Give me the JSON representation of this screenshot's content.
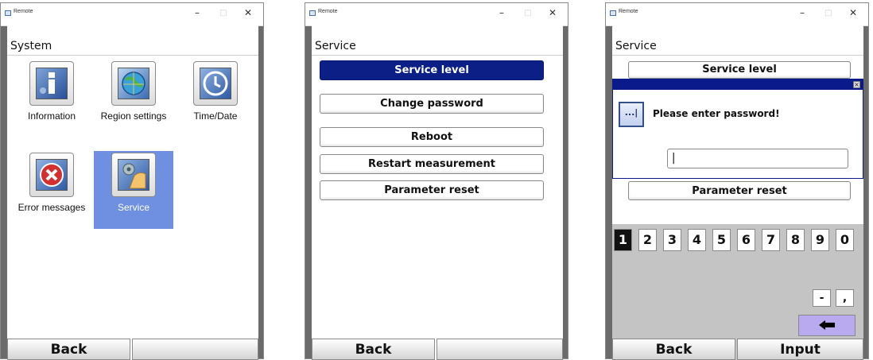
{
  "window": {
    "title": "Remote",
    "controls": {
      "minimize": "–",
      "maximize": "□",
      "close": "✕"
    }
  },
  "panel1": {
    "heading": "System",
    "tiles": [
      {
        "label": "Information",
        "icon": "info-icon"
      },
      {
        "label": "Region settings",
        "icon": "globe-icon"
      },
      {
        "label": "Time/Date",
        "icon": "clock-icon"
      },
      {
        "label": "Error messages",
        "icon": "error-icon"
      },
      {
        "label": "Service",
        "icon": "service-icon",
        "selected": true
      }
    ],
    "bottom": {
      "left": "Back",
      "right": ""
    }
  },
  "panel2": {
    "heading": "Service",
    "buttons": [
      {
        "label": "Service level",
        "active": true
      },
      {
        "label": "Change password"
      },
      {
        "label": "Reboot"
      },
      {
        "label": "Restart measurement"
      },
      {
        "label": "Parameter reset"
      }
    ],
    "bottom": {
      "left": "Back",
      "right": ""
    }
  },
  "panel3": {
    "heading": "Service",
    "service_level": "Service level",
    "parameter_reset": "Parameter reset",
    "dialog": {
      "close": "×",
      "icon_text": "...|",
      "prompt": "Please enter password!",
      "input_value": "|"
    },
    "keys": [
      "1",
      "2",
      "3",
      "4",
      "5",
      "6",
      "7",
      "8",
      "9",
      "0"
    ],
    "active_key": "1",
    "extra_keys": [
      "-",
      ","
    ],
    "backspace": "🡰",
    "bottom": {
      "left": "Back",
      "right": "Input"
    }
  },
  "colors": {
    "selection": "#6f8fe0",
    "active_button": "#0b1f86",
    "dialog_bar": "#0a1a8a",
    "backspace": "#b9a9ee"
  }
}
